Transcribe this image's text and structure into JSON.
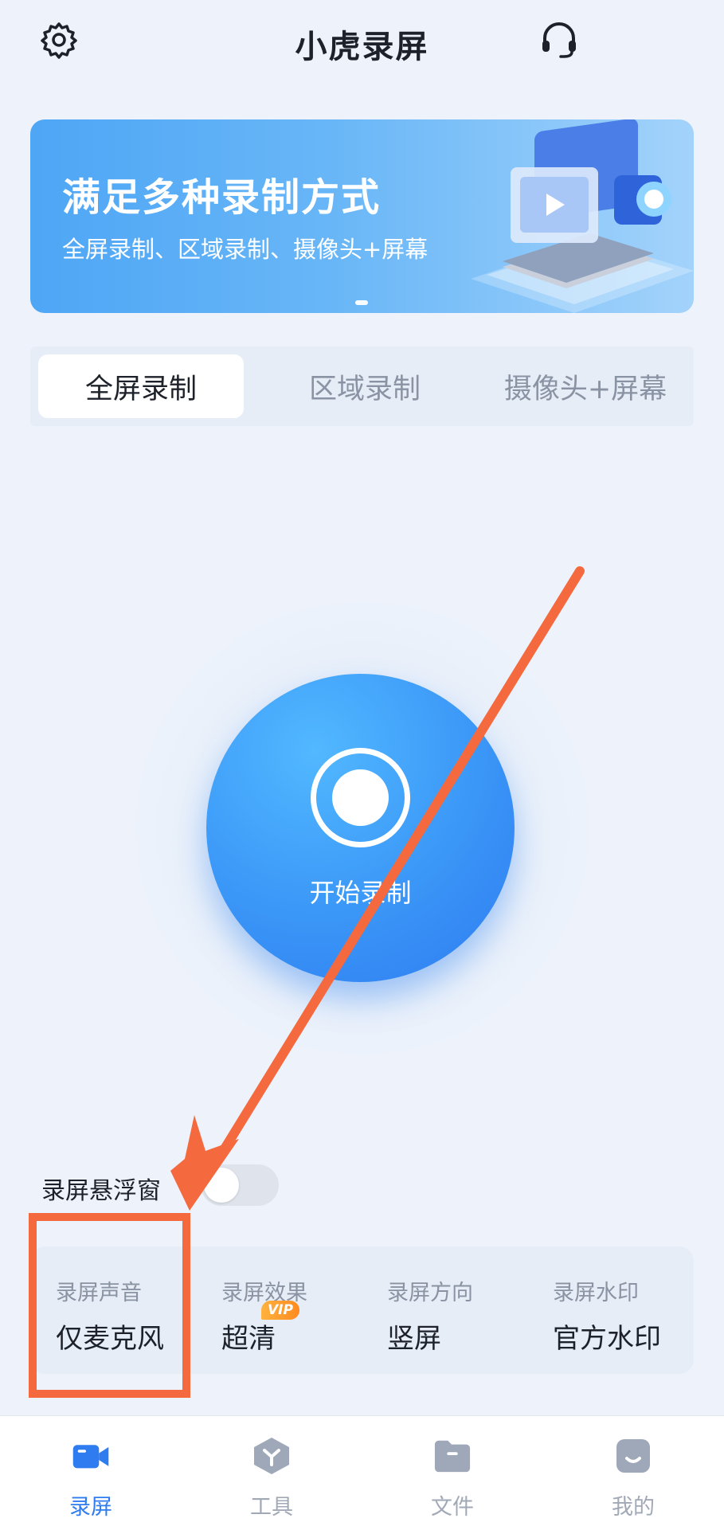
{
  "header": {
    "title": "小虎录屏",
    "settings_icon": "gear-icon",
    "support_icon": "headset-icon"
  },
  "banner": {
    "title": "满足多种录制方式",
    "subtitle": "全屏录制、区域录制、摄像头+屏幕",
    "art_icon": "video-camera-illustration",
    "page_count": 1
  },
  "tabs": [
    {
      "label": "全屏录制",
      "active": true
    },
    {
      "label": "区域录制",
      "active": false
    },
    {
      "label": "摄像头+屏幕",
      "active": false
    }
  ],
  "record": {
    "label": "开始录制",
    "icon": "record-circle-icon"
  },
  "floating_window": {
    "label": "录屏悬浮窗",
    "enabled": false
  },
  "settings": [
    {
      "label": "录屏声音",
      "value": "仅麦克风"
    },
    {
      "label": "录屏效果",
      "value": "超清",
      "badge": "VIP"
    },
    {
      "label": "录屏方向",
      "value": "竖屏"
    },
    {
      "label": "录屏水印",
      "value": "官方水印"
    }
  ],
  "bottom_nav": [
    {
      "label": "录屏",
      "icon": "video-camera-icon",
      "active": true
    },
    {
      "label": "工具",
      "icon": "toolbox-icon",
      "active": false
    },
    {
      "label": "文件",
      "icon": "folder-icon",
      "active": false
    },
    {
      "label": "我的",
      "icon": "profile-icon",
      "active": false
    }
  ],
  "colors": {
    "accent": "#2f7cf0",
    "annotation": "#f46a3e",
    "background": "#eef3fb",
    "vip": "#ff8a1f"
  }
}
